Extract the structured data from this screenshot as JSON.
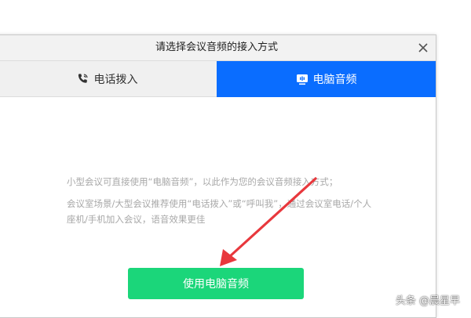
{
  "dialog": {
    "title": "请选择会议音频的接入方式",
    "close_icon": "close-icon"
  },
  "tabs": [
    {
      "label": "电话拨入",
      "icon": "phone-icon",
      "active": false
    },
    {
      "label": "电脑音频",
      "icon": "computer-audio-icon",
      "active": true
    }
  ],
  "content": {
    "paragraph1": "小型会议可直接使用“电脑音频”，以此作为您的会议音频接入方式；",
    "paragraph2": "会议室场景/大型会议推荐使用“电话拨入”或“呼叫我”，通过会议室电话/个人座机/手机加入会议，语音效果更佳",
    "button_label": "使用电脑音频"
  },
  "annotation": {
    "arrow_color": "#e8383d"
  },
  "watermark": "头条 @晨星早",
  "colors": {
    "accent_blue": "#0a6dff",
    "button_green": "#1bd67a",
    "arrow_red": "#e8383d"
  }
}
